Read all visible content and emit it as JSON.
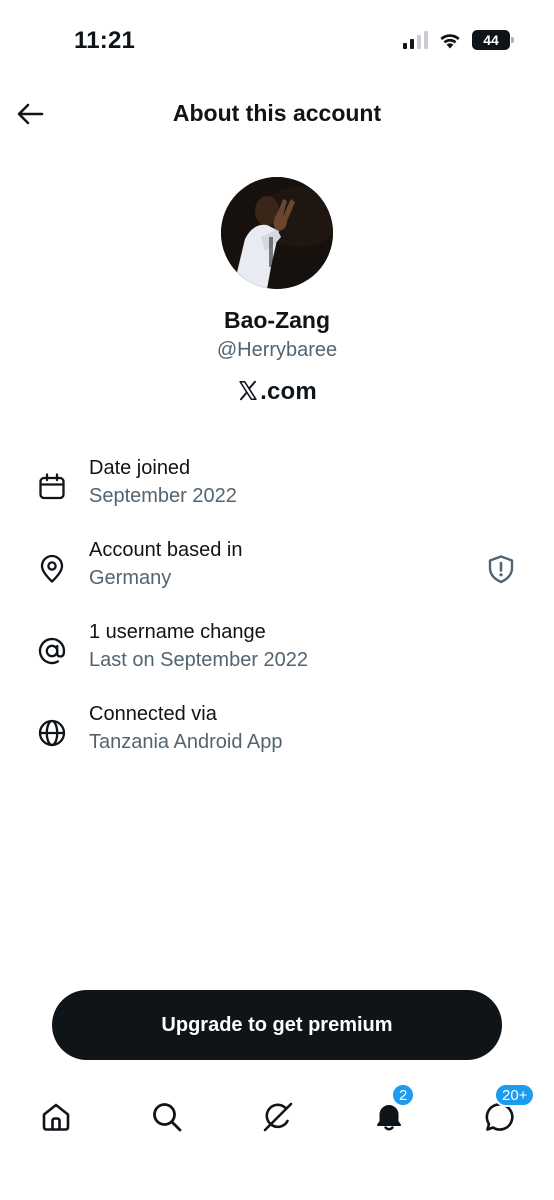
{
  "status_bar": {
    "time": "11:21",
    "battery": "44",
    "icons": [
      "cellular-signal-icon",
      "wifi-icon",
      "battery-icon"
    ]
  },
  "header": {
    "title": "About this account",
    "back_icon": "arrow-left-icon"
  },
  "profile": {
    "display_name": "Bao-Zang",
    "handle": "@Herrybaree",
    "site": ".com",
    "site_logo": "x-logo-icon"
  },
  "info": [
    {
      "icon": "calendar-icon",
      "title": "Date joined",
      "subtitle": "September 2022"
    },
    {
      "icon": "location-pin-icon",
      "title": "Account based in",
      "subtitle": "Germany",
      "trailing_icon": "shield-alert-icon"
    },
    {
      "icon": "at-sign-icon",
      "title": "1 username change",
      "subtitle": "Last on September 2022"
    },
    {
      "icon": "globe-icon",
      "title": "Connected via",
      "subtitle": "Tanzania Android App"
    }
  ],
  "cta": {
    "label": "Upgrade to get premium"
  },
  "bottom_nav": {
    "items": [
      "home-icon",
      "search-icon",
      "grok-icon",
      "notifications-icon",
      "messages-icon"
    ],
    "notifications_badge": "2",
    "messages_badge": "20+"
  },
  "colors": {
    "text_primary": "#0f1419",
    "text_secondary": "#536471",
    "button_bg": "#0f1419",
    "badge_blue": "#1d9bf0"
  }
}
